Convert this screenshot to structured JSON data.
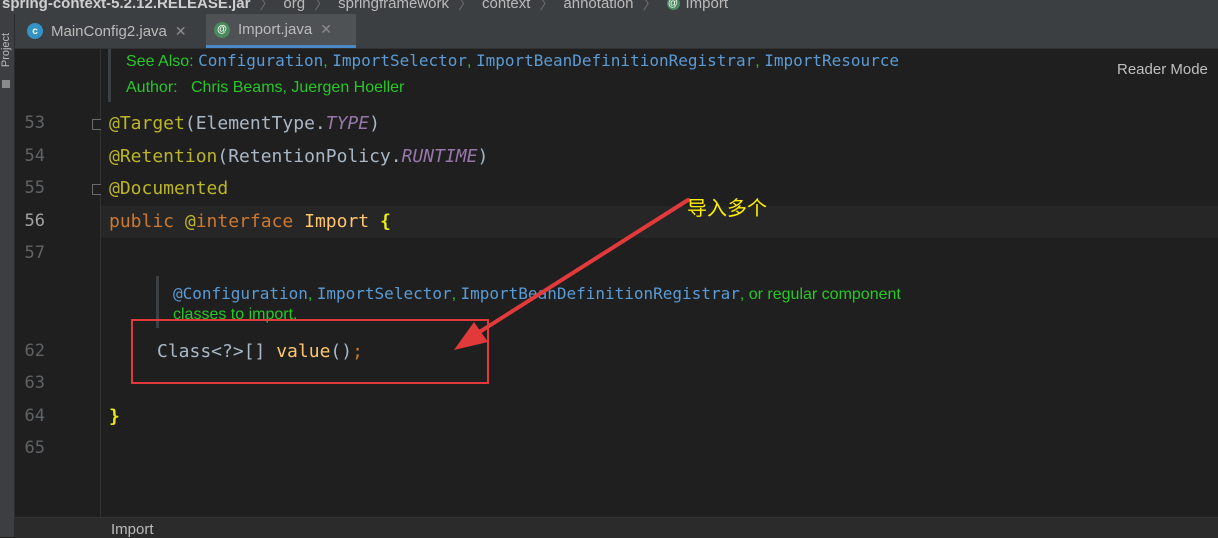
{
  "breadcrumb": {
    "items": [
      "spring-context-5.2.12.RELEASE.jar",
      "org",
      "springframework",
      "context",
      "annotation",
      "Import"
    ]
  },
  "toolstrip": {
    "project_label": "Project"
  },
  "tabs": [
    {
      "label": "MainConfig2.java",
      "icon": "class-icon",
      "active": false
    },
    {
      "label": "Import.java",
      "icon": "annotation-icon",
      "active": true
    }
  ],
  "reader_mode": "Reader Mode",
  "doc_comment": {
    "see_also_label": "See Also:",
    "see_also_links": [
      "Configuration",
      "ImportSelector",
      "ImportBeanDefinitionRegistrar",
      "ImportResource"
    ],
    "author_label": "Author:",
    "authors": "Chris Beams, Juergen Hoeller",
    "inner_links": [
      "@Configuration",
      "ImportSelector",
      "ImportBeanDefinitionRegistrar"
    ],
    "inner_text_1": ", or regular component",
    "inner_text_2": "classes to import."
  },
  "line_numbers": [
    "53",
    "54",
    "55",
    "56",
    "57",
    "62",
    "63",
    "64",
    "65"
  ],
  "code": {
    "l53_ann": "@Target",
    "l53_open": "(ElementType.",
    "l53_const": "TYPE",
    "l53_close": ")",
    "l54_ann": "@Retention",
    "l54_open": "(RetentionPolicy.",
    "l54_const": "RUNTIME",
    "l54_close": ")",
    "l55_ann": "@Documented",
    "l56_public": "public",
    "l56_at": "@",
    "l56_interface": "interface",
    "l56_name": "Import",
    "l56_brace": "{",
    "l62_type": "Class<?>[]",
    "l62_method": "value",
    "l62_parens": "()",
    "l62_semi": ";",
    "l64_brace": "}"
  },
  "annotation_note": "导入多个",
  "status_breadcrumb": "Import",
  "colors": {
    "annotation": "#bbb529",
    "keyword": "#cc7832",
    "doc_text": "#28c728",
    "doc_link": "#5a9bd5",
    "highlight_box": "#e23a3a",
    "note": "#ffef00"
  }
}
